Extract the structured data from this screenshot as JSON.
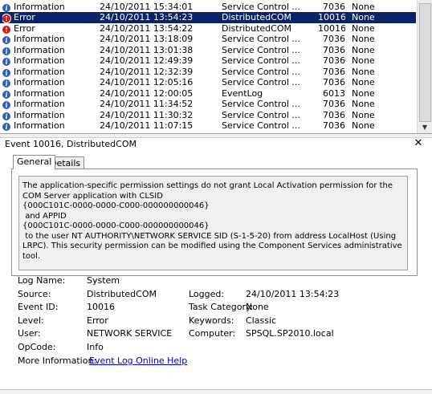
{
  "events": [
    {
      "level": "Information",
      "icon": "info-icon",
      "date": "24/10/2011 15:34:01",
      "source": "Service Control ...",
      "id": "7036",
      "task": "None",
      "selected": false
    },
    {
      "level": "Error",
      "icon": "error-icon",
      "date": "24/10/2011 13:54:23",
      "source": "DistributedCOM",
      "id": "10016",
      "task": "None",
      "selected": true
    },
    {
      "level": "Error",
      "icon": "error-icon",
      "date": "24/10/2011 13:54:22",
      "source": "DistributedCOM",
      "id": "10016",
      "task": "None",
      "selected": false
    },
    {
      "level": "Information",
      "icon": "info-icon",
      "date": "24/10/2011 13:18:09",
      "source": "Service Control ...",
      "id": "7036",
      "task": "None",
      "selected": false
    },
    {
      "level": "Information",
      "icon": "info-icon",
      "date": "24/10/2011 13:01:38",
      "source": "Service Control ...",
      "id": "7036",
      "task": "None",
      "selected": false
    },
    {
      "level": "Information",
      "icon": "info-icon",
      "date": "24/10/2011 12:49:39",
      "source": "Service Control ...",
      "id": "7036",
      "task": "None",
      "selected": false
    },
    {
      "level": "Information",
      "icon": "info-icon",
      "date": "24/10/2011 12:32:39",
      "source": "Service Control ...",
      "id": "7036",
      "task": "None",
      "selected": false
    },
    {
      "level": "Information",
      "icon": "info-icon",
      "date": "24/10/2011 12:05:16",
      "source": "Service Control ...",
      "id": "7036",
      "task": "None",
      "selected": false
    },
    {
      "level": "Information",
      "icon": "info-icon",
      "date": "24/10/2011 12:00:05",
      "source": "EventLog",
      "id": "6013",
      "task": "None",
      "selected": false
    },
    {
      "level": "Information",
      "icon": "info-icon",
      "date": "24/10/2011 11:34:52",
      "source": "Service Control ...",
      "id": "7036",
      "task": "None",
      "selected": false
    },
    {
      "level": "Information",
      "icon": "info-icon",
      "date": "24/10/2011 11:30:32",
      "source": "Service Control ...",
      "id": "7036",
      "task": "None",
      "selected": false
    },
    {
      "level": "Information",
      "icon": "info-icon",
      "date": "24/10/2011 11:07:15",
      "source": "Service Control ...",
      "id": "7036",
      "task": "None",
      "selected": false
    }
  ],
  "colors": {
    "selected_row": "#0a246a",
    "info_icon": "#2a5fc0",
    "error_icon": "#c8201c",
    "link": "#0000cc"
  },
  "detail": {
    "title": "Event 10016, DistributedCOM",
    "close_icon": "close-icon",
    "tabs": [
      {
        "label": "General",
        "active": true
      },
      {
        "label": "Details",
        "active": false
      }
    ],
    "message_lines": [
      "The application-specific permission settings do not grant Local Activation permission for the COM Server application with CLSID",
      "{000C101C-0000-0000-C000-000000000046}",
      " and APPID",
      "{000C101C-0000-0000-C000-000000000046}",
      " to the user NT AUTHORITY\\NETWORK SERVICE SID (S-1-5-20) from address LocalHost (Using LRPC). This security permission can be modified using the Component Services administrative tool."
    ],
    "fields": {
      "log_name_label": "Log Name:",
      "log_name": "System",
      "source_label": "Source:",
      "source": "DistributedCOM",
      "logged_label": "Logged:",
      "logged": "24/10/2011 13:54:23",
      "event_id_label": "Event ID:",
      "event_id": "10016",
      "task_category_label": "Task Category:",
      "task_category": "None",
      "level_label": "Level:",
      "level": "Error",
      "keywords_label": "Keywords:",
      "keywords": "Classic",
      "user_label": "User:",
      "user": "NETWORK SERVICE",
      "computer_label": "Computer:",
      "computer": "SPSQL.SP2010.local",
      "opcode_label": "OpCode:",
      "opcode": "Info",
      "more_info_label": "More Information:",
      "more_info_link": "Event Log Online Help"
    }
  }
}
